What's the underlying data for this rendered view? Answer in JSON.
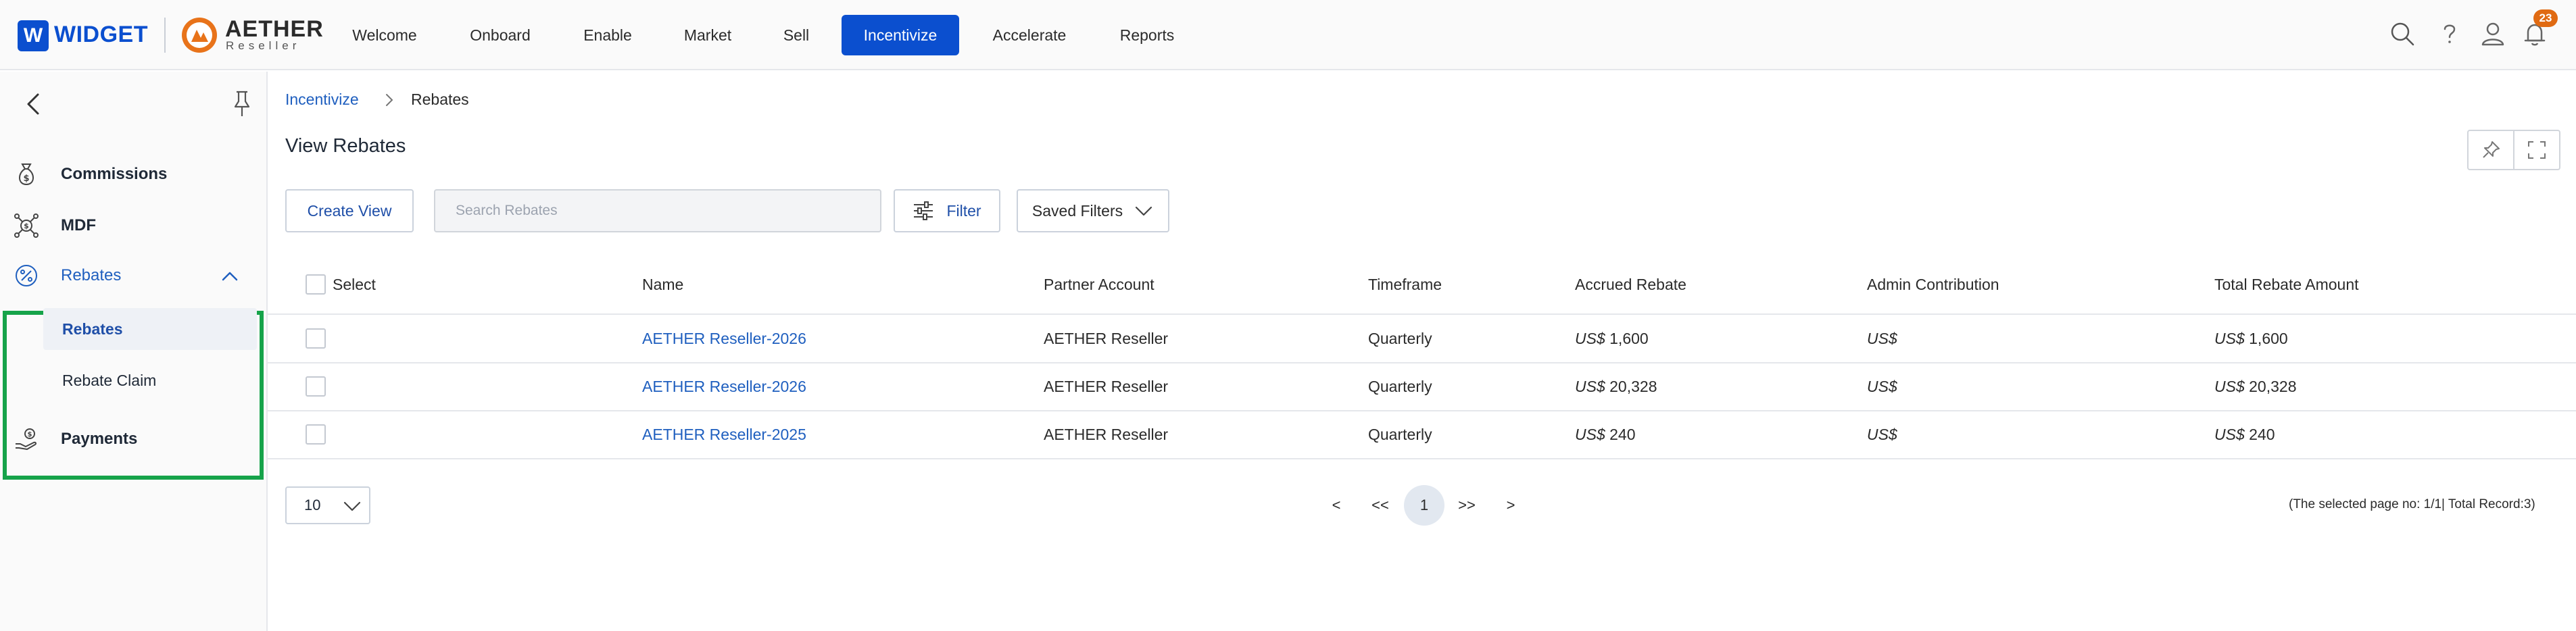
{
  "header": {
    "logo_letter": "W",
    "logo_text": "WIDGET",
    "partner_name": "AETHER",
    "partner_sub": "Reseller",
    "nav": [
      {
        "label": "Welcome"
      },
      {
        "label": "Onboard"
      },
      {
        "label": "Enable"
      },
      {
        "label": "Market"
      },
      {
        "label": "Sell"
      },
      {
        "label": "Incentivize",
        "active": true
      },
      {
        "label": "Accelerate"
      },
      {
        "label": "Reports"
      }
    ],
    "notification_count": "23",
    "icons": [
      "search-icon",
      "help-icon",
      "user-icon",
      "bell-icon"
    ],
    "accent_color": "#0b4fcf"
  },
  "sidebar": {
    "items": [
      {
        "label": "Commissions",
        "icon": "money-bag-icon"
      },
      {
        "label": "MDF",
        "icon": "dollar-network-icon"
      },
      {
        "label": "Rebates",
        "icon": "percent-icon",
        "expanded": true
      },
      {
        "label": "Payments",
        "icon": "hand-coin-icon"
      }
    ],
    "rebates_sub": [
      {
        "label": "Rebates",
        "active": true
      },
      {
        "label": "Rebate Claim"
      }
    ],
    "highlight_color": "#16a34a"
  },
  "breadcrumb": {
    "parent": "Incentivize",
    "current": "Rebates"
  },
  "page": {
    "title": "View Rebates"
  },
  "toolbar": {
    "create_view": "Create View",
    "search_placeholder": "Search Rebates",
    "filter": "Filter",
    "saved_filters": "Saved Filters"
  },
  "table": {
    "columns": [
      "Select",
      "Name",
      "Partner Account",
      "Timeframe",
      "Accrued Rebate",
      "Admin Contribution",
      "Total Rebate Amount"
    ],
    "currency": "US$",
    "rows": [
      {
        "name": "AETHER Reseller-2026",
        "partner": "AETHER Reseller",
        "timeframe": "Quarterly",
        "accrued": "1,600",
        "admin": "",
        "total": "1,600"
      },
      {
        "name": "AETHER Reseller-2026",
        "partner": "AETHER Reseller",
        "timeframe": "Quarterly",
        "accrued": "20,328",
        "admin": "",
        "total": "20,328"
      },
      {
        "name": "AETHER Reseller-2025",
        "partner": "AETHER Reseller",
        "timeframe": "Quarterly",
        "accrued": "240",
        "admin": "",
        "total": "240"
      }
    ]
  },
  "pagination": {
    "page_size": "10",
    "prev": "<",
    "first": "<<",
    "current": "1",
    "last": ">>",
    "next": ">",
    "info": "(The selected page no: 1/1| Total Record:3)"
  }
}
